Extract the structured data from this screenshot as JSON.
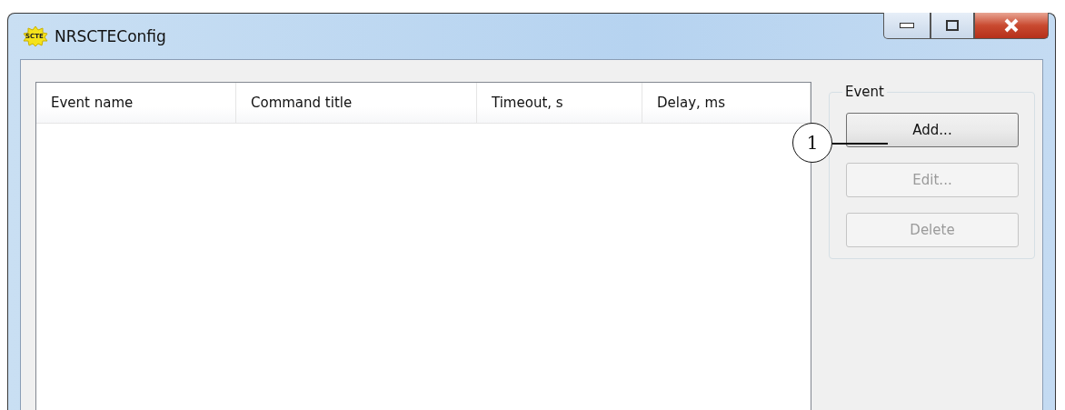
{
  "window": {
    "title": "NRSCTEConfig",
    "icon_text": "SCTE"
  },
  "table": {
    "columns": [
      "Event name",
      "Command title",
      "Timeout, s",
      "Delay, ms"
    ]
  },
  "event_group": {
    "title": "Event",
    "buttons": [
      {
        "label": "Add...",
        "disabled": false
      },
      {
        "label": "Edit...",
        "disabled": true
      },
      {
        "label": "Delete",
        "disabled": true
      }
    ]
  },
  "callout": {
    "label": "1"
  }
}
